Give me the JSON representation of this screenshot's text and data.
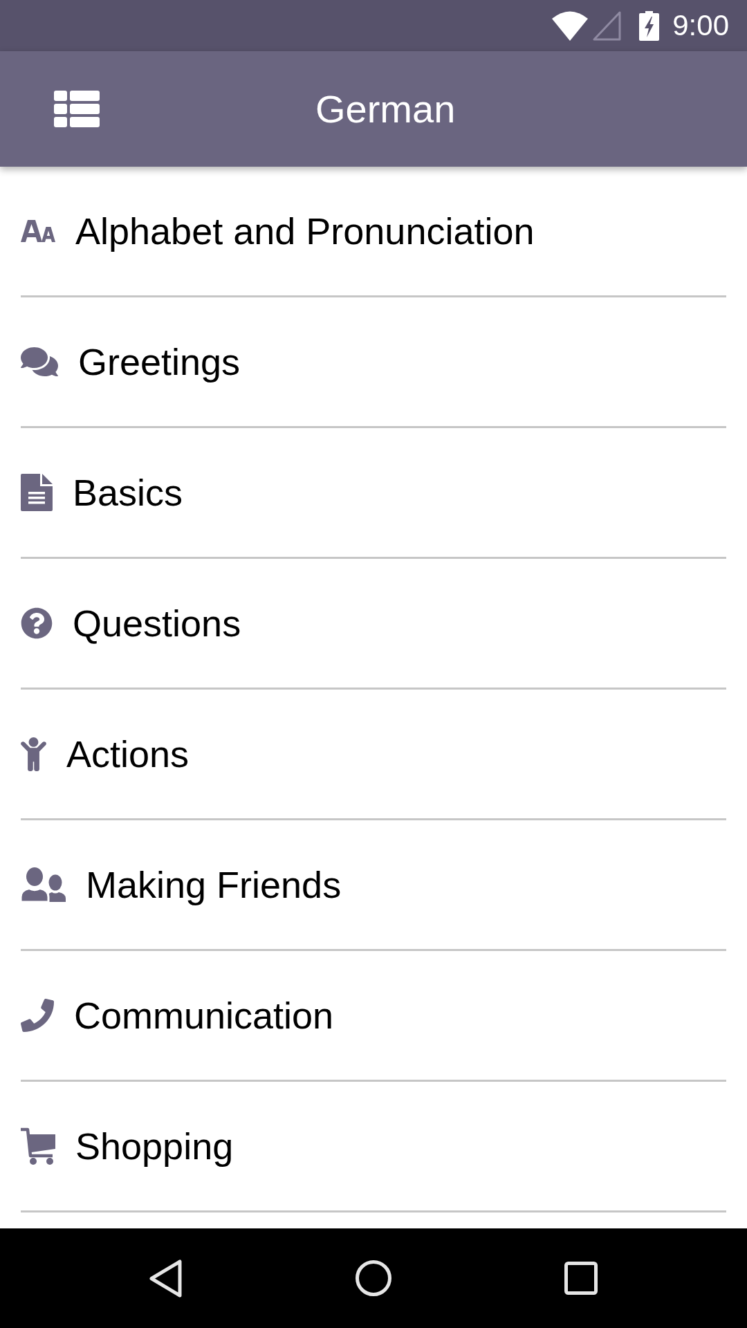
{
  "status_bar": {
    "time": "9:00"
  },
  "app_bar": {
    "title": "German"
  },
  "categories": [
    {
      "label": "Alphabet and Pronunciation"
    },
    {
      "label": "Greetings"
    },
    {
      "label": "Basics"
    },
    {
      "label": "Questions"
    },
    {
      "label": "Actions"
    },
    {
      "label": "Making Friends"
    },
    {
      "label": "Communication"
    },
    {
      "label": "Shopping"
    }
  ]
}
